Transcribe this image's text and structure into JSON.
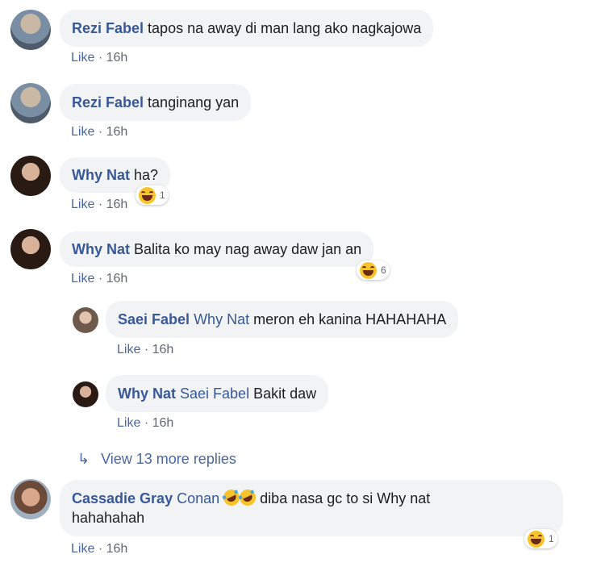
{
  "comments": [
    {
      "author": "Rezi Fabel",
      "text": "tapos na away di man lang ako nagkajowa",
      "like": "Like",
      "time": "16h"
    },
    {
      "author": "Rezi Fabel",
      "text": "tanginang yan",
      "like": "Like",
      "time": "16h"
    },
    {
      "author": "Why Nat",
      "text": "ha?",
      "like": "Like",
      "time": "16h",
      "reaction_count": "1"
    },
    {
      "author": "Why Nat",
      "text": "Balita ko may nag away daw jan an",
      "like": "Like",
      "time": "16h",
      "reaction_count": "6"
    }
  ],
  "replies": [
    {
      "author": "Saei Fabel",
      "tag": "Why Nat",
      "text": "meron eh kanina HAHAHAHA",
      "like": "Like",
      "time": "16h"
    },
    {
      "author": "Why Nat",
      "tag": "Saei Fabel",
      "text": "Bakit daw",
      "like": "Like",
      "time": "16h"
    }
  ],
  "view_more": {
    "arrow": "↳",
    "label": "View 13 more replies"
  },
  "last_comment": {
    "author": "Cassadie Gray",
    "tag": "Conan",
    "text_line1": "diba nasa gc to si Why nat",
    "text_line2": "hahahahah",
    "like": "Like",
    "time": "16h",
    "reaction_count": "1"
  },
  "separator": "·",
  "colors": {
    "name": "#385898",
    "bubble": "#f2f3f5",
    "like": "#4b67a1",
    "meta": "#606770"
  }
}
